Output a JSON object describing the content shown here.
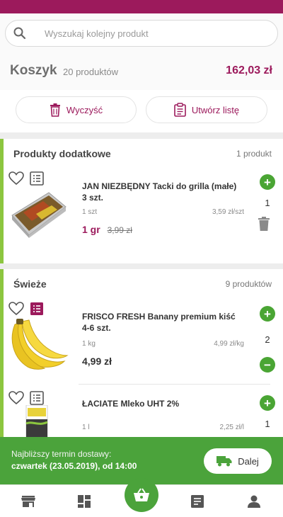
{
  "search": {
    "placeholder": "Wyszukaj kolejny produkt"
  },
  "basket": {
    "title": "Koszyk",
    "count": "20 produktów",
    "total": "162,03 zł"
  },
  "actions": {
    "clear_label": "Wyczyść",
    "create_list_label": "Utwórz listę"
  },
  "sections": [
    {
      "title": "Produkty dodatkowe",
      "count": "1 produkt",
      "products": [
        {
          "name": "JAN NIEZBĘDNY Tacki do grilla (małe) 3 szt.",
          "unit": "1 szt",
          "per_unit": "3,59 zł/szt",
          "price": "1 gr",
          "old_price": "3,99 zł",
          "qty": "1",
          "note_active": false
        }
      ]
    },
    {
      "title": "Świeże",
      "count": "9 produktów",
      "products": [
        {
          "name": "FRISCO FRESH Banany premium kiść 4-6 szt.",
          "unit": "1 kg",
          "per_unit": "4,99 zł/kg",
          "price": "4,99 zł",
          "qty": "2",
          "note_active": true
        },
        {
          "name": "ŁACIATE Mleko UHT 2%",
          "unit": "1 l",
          "per_unit": "2,25 zł/l",
          "qty": "1",
          "note_active": false
        }
      ]
    }
  ],
  "delivery": {
    "line1": "Najbliższy termin dostawy:",
    "line2": "czwartek (23.05.2019), od 14:00",
    "button_label": "Dalej"
  },
  "tabs": [
    "store-icon",
    "categories-icon",
    "basket-icon",
    "list-icon",
    "account-icon"
  ],
  "colors": {
    "brand": "#9c1a5c",
    "green": "#4ba33b",
    "section_accent": "#8cc63f"
  }
}
